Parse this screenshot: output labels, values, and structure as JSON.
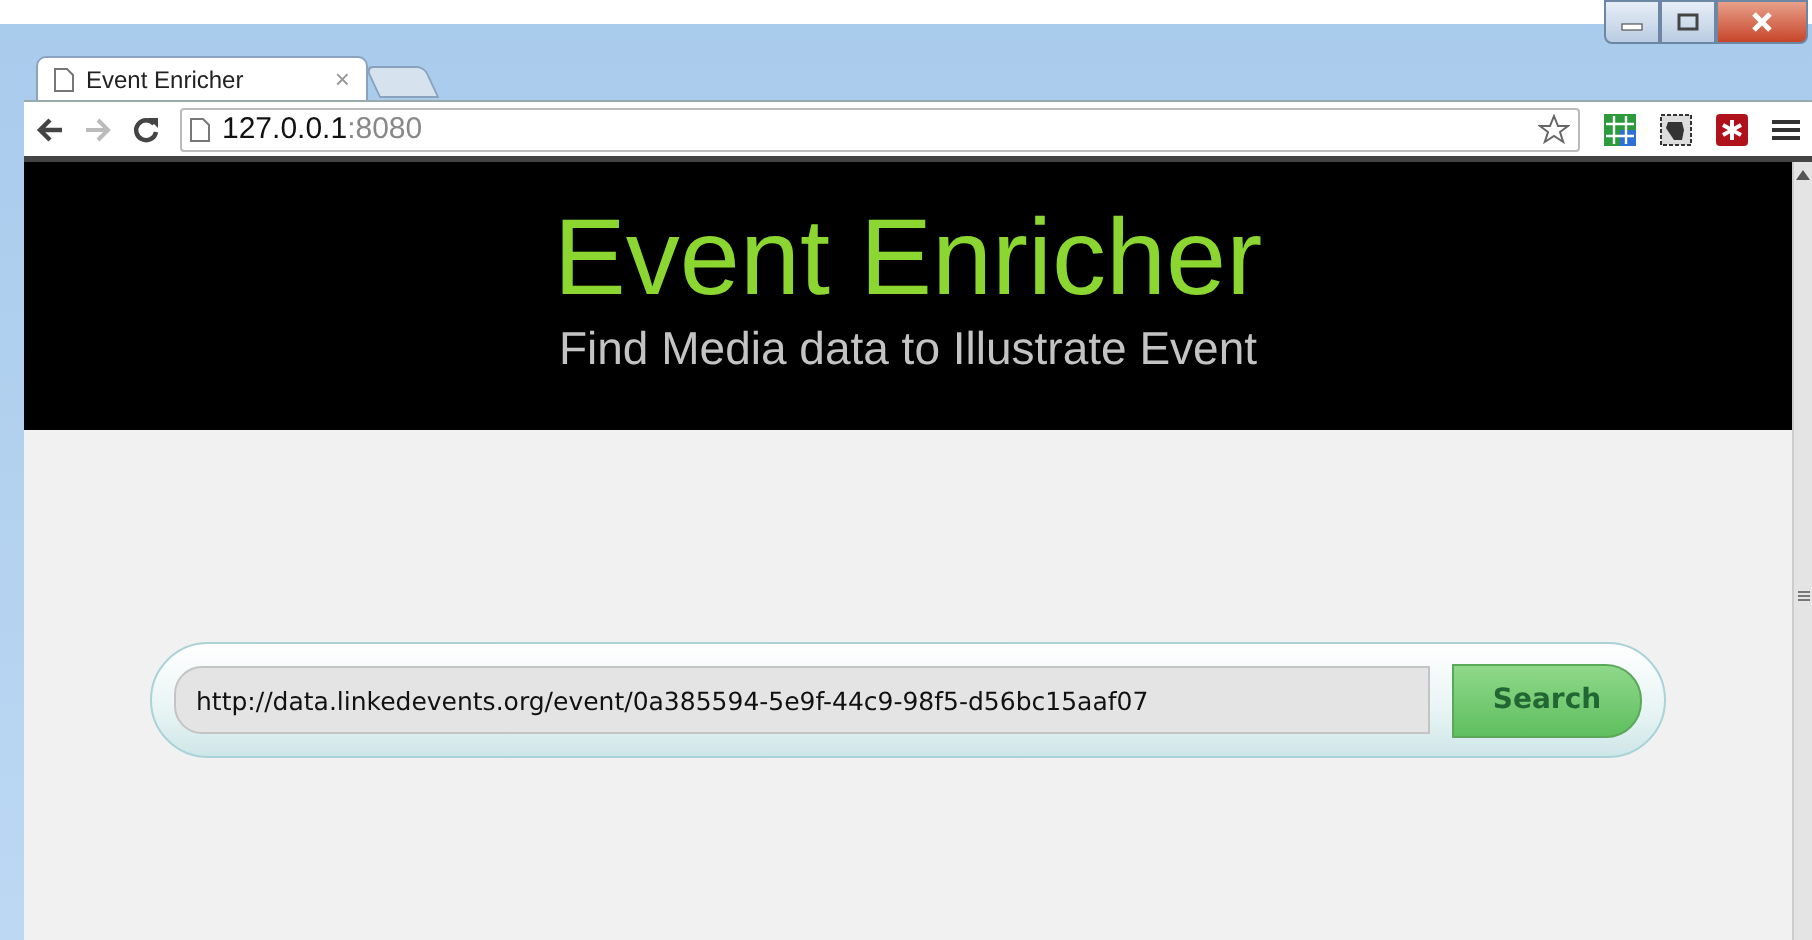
{
  "browser": {
    "tab": {
      "title": "Event Enricher",
      "close": "×",
      "selected": true
    },
    "address": {
      "host": "127.0.0.1",
      "port": ":8080"
    }
  },
  "header": {
    "title": "Event Enricher",
    "subtitle": "Find Media data to Illustrate Event"
  },
  "search": {
    "value": "http://data.linkedevents.org/event/0a385594-5e9f-44c9-98f5-d56bc15aaf07",
    "button": "Search"
  }
}
